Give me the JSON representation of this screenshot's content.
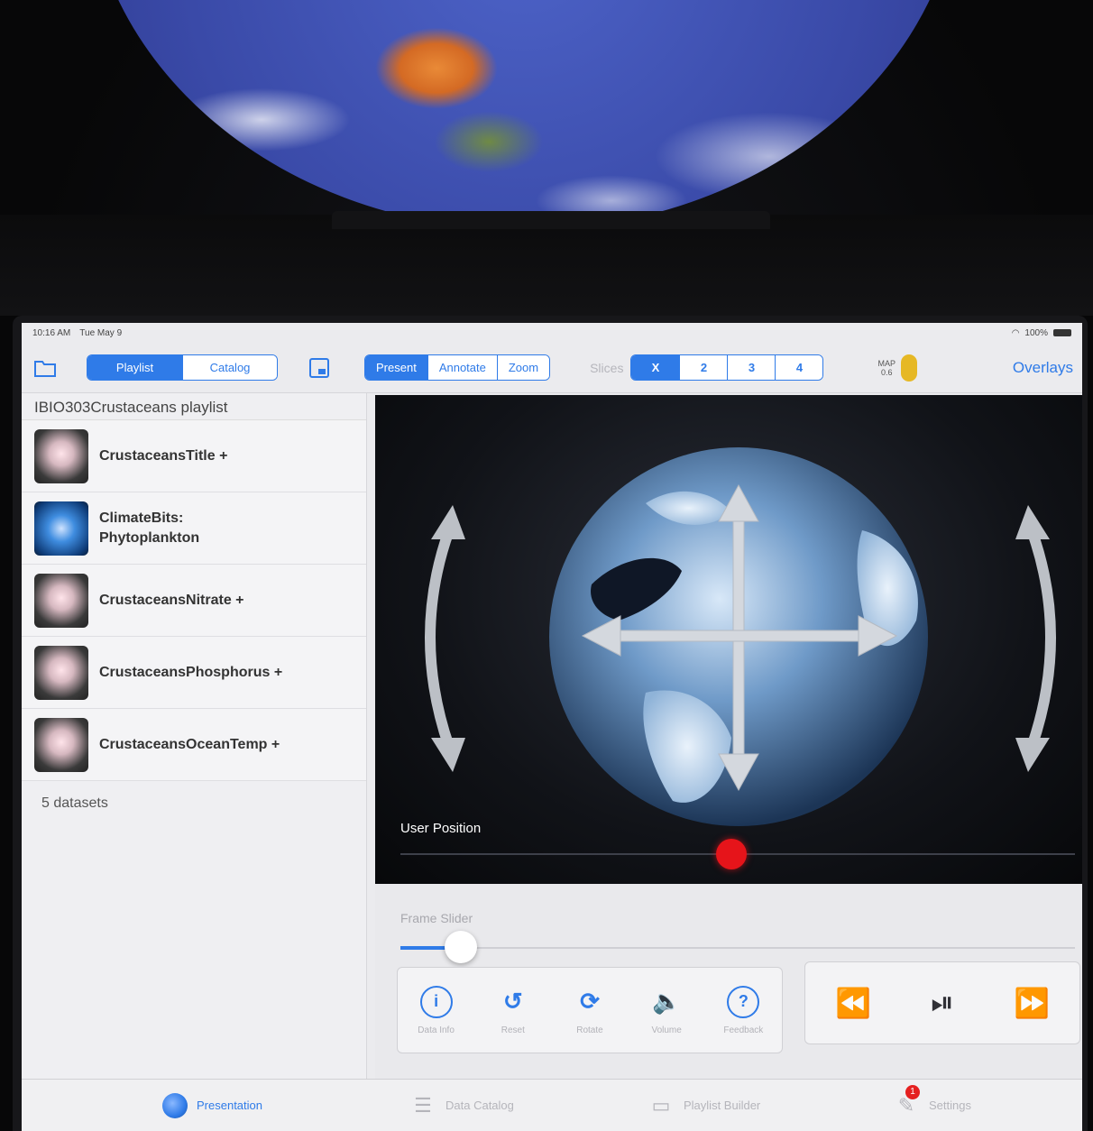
{
  "status_bar": {
    "time": "10:16 AM",
    "date": "Tue May 9",
    "battery": "100%"
  },
  "navbar": {
    "left_segments": [
      {
        "label": "Playlist",
        "active": true
      },
      {
        "label": "Catalog",
        "active": false
      }
    ],
    "mode_segments": [
      {
        "label": "Present",
        "active": true
      },
      {
        "label": "Annotate",
        "active": false
      },
      {
        "label": "Zoom",
        "active": false
      }
    ],
    "slices_label": "Slices",
    "slices": [
      {
        "label": "X",
        "active": true
      },
      {
        "label": "2",
        "active": false
      },
      {
        "label": "3",
        "active": false
      },
      {
        "label": "4",
        "active": false
      }
    ],
    "map_badge": {
      "line1": "MAP",
      "line2": "0.6"
    },
    "overlays_label": "Overlays"
  },
  "sidebar": {
    "playlist_title": "IBIO303Crustaceans playlist",
    "items": [
      {
        "label": "CrustaceansTitle +",
        "thumb": "crustacean"
      },
      {
        "label": "ClimateBits: Phytoplankton",
        "thumb": "globe"
      },
      {
        "label": "CrustaceansNitrate +",
        "thumb": "crustacean"
      },
      {
        "label": "CrustaceansPhosphorus +",
        "thumb": "crustacean"
      },
      {
        "label": "CrustaceansOceanTemp +",
        "thumb": "crustacean"
      }
    ],
    "dataset_count": "5 datasets"
  },
  "viewer": {
    "user_position_label": "User Position",
    "user_position_value": 0.49
  },
  "frame": {
    "label": "Frame Slider",
    "value": 0.09
  },
  "tools": [
    {
      "glyph": "i",
      "label": "Data Info",
      "icon": "info-icon"
    },
    {
      "glyph": "↺",
      "label": "Reset",
      "icon": "reset-icon"
    },
    {
      "glyph": "⟳",
      "label": "Rotate",
      "icon": "rotate-icon"
    },
    {
      "glyph": "🔈",
      "label": "Volume",
      "icon": "volume-icon"
    },
    {
      "glyph": "?",
      "label": "Feedback",
      "icon": "help-icon"
    }
  ],
  "transport": [
    {
      "glyph": "⏪",
      "icon": "rewind-icon"
    },
    {
      "glyph": "⏯",
      "icon": "play-pause-icon"
    },
    {
      "glyph": "⏩",
      "icon": "fast-forward-icon"
    }
  ],
  "tabs": [
    {
      "label": "Presentation",
      "active": true,
      "icon": "globe-icon"
    },
    {
      "label": "Data Catalog",
      "active": false,
      "icon": "list-icon"
    },
    {
      "label": "Playlist Builder",
      "active": false,
      "icon": "builder-icon"
    },
    {
      "label": "Settings",
      "active": false,
      "icon": "settings-icon",
      "badge": "1"
    }
  ],
  "colors": {
    "accent": "#2f7be8",
    "user_knob": "#e6141a"
  }
}
